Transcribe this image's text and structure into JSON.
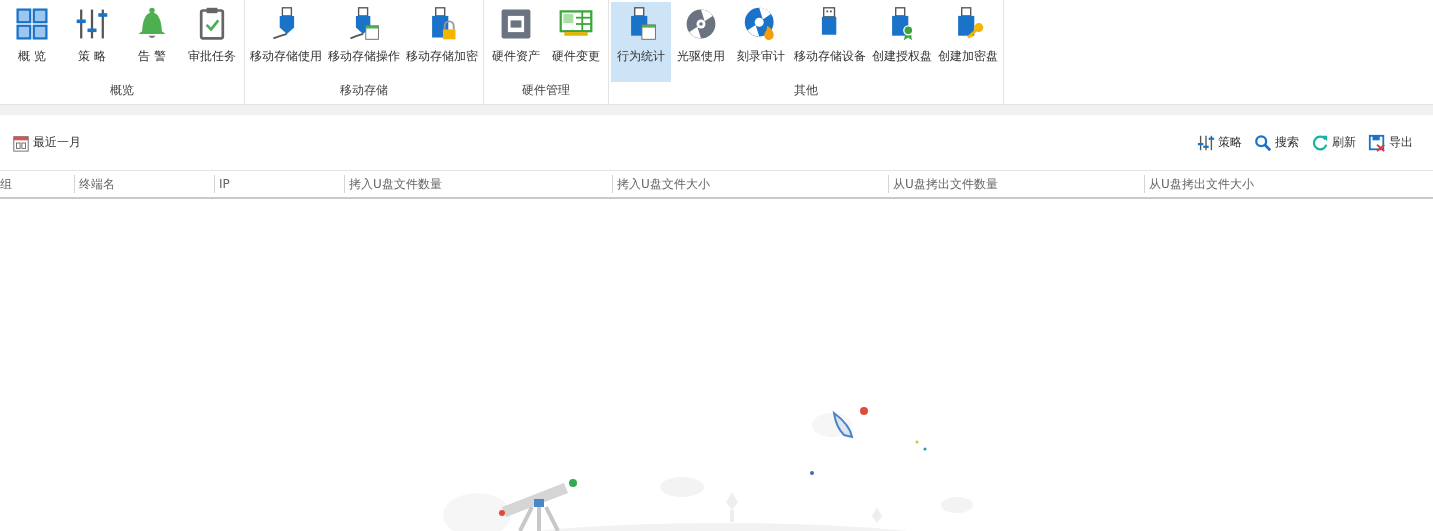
{
  "ribbon": {
    "groups": [
      {
        "label": "概览",
        "items": [
          {
            "label": "概 览",
            "selected": false
          },
          {
            "label": "策 略",
            "selected": false
          },
          {
            "label": "告 警",
            "selected": false
          },
          {
            "label": "审批任务",
            "selected": false
          }
        ]
      },
      {
        "label": "移动存储",
        "items": [
          {
            "label": "移动存储使用",
            "selected": false
          },
          {
            "label": "移动存储操作",
            "selected": false
          },
          {
            "label": "移动存储加密",
            "selected": false
          }
        ]
      },
      {
        "label": "硬件管理",
        "items": [
          {
            "label": "硬件资产",
            "selected": false
          },
          {
            "label": "硬件变更",
            "selected": false
          }
        ]
      },
      {
        "label": "其他",
        "items": [
          {
            "label": "行为统计",
            "selected": true
          },
          {
            "label": "光驱使用",
            "selected": false
          },
          {
            "label": "刻录审计",
            "selected": false
          },
          {
            "label": "移动存储设备",
            "selected": false
          },
          {
            "label": "创建授权盘",
            "selected": false
          },
          {
            "label": "创建加密盘",
            "selected": false
          }
        ]
      }
    ]
  },
  "toolbar": {
    "date_range": "最近一月",
    "actions": [
      {
        "label": "策略"
      },
      {
        "label": "搜索"
      },
      {
        "label": "刷新"
      },
      {
        "label": "导出"
      }
    ]
  },
  "table": {
    "columns": [
      "组",
      "终端名",
      "IP",
      "拷入U盘文件数量",
      "拷入U盘文件大小",
      "从U盘拷出文件数量",
      "从U盘拷出文件大小"
    ]
  }
}
